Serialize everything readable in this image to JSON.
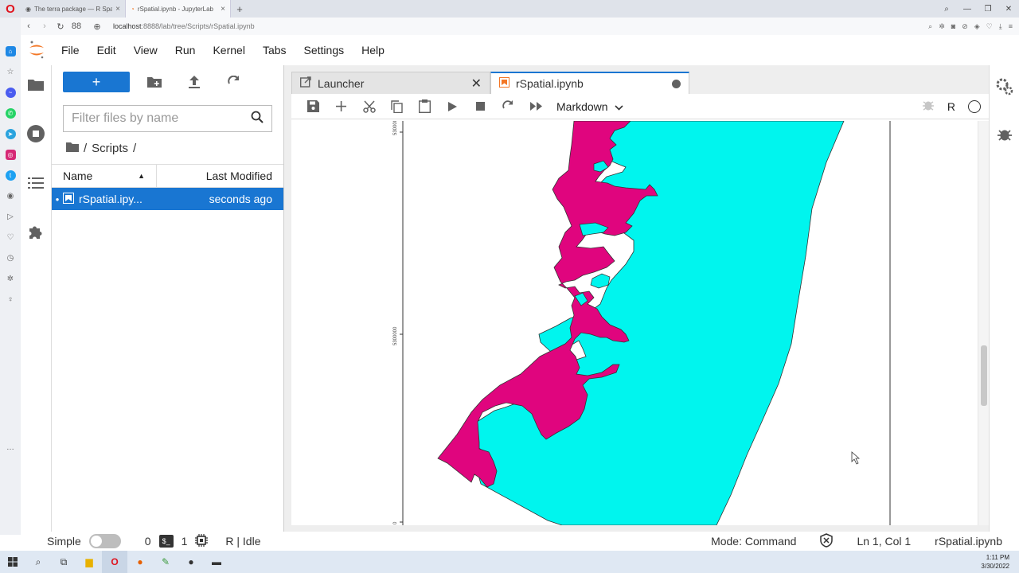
{
  "browser": {
    "tabs": [
      {
        "title": "The terra package — R Spa",
        "active": false
      },
      {
        "title": "rSpatial.ipynb - JupyterLab",
        "active": true
      }
    ],
    "address": {
      "host": "localhost",
      "path": ":8888/lab/tree/Scripts/rSpatial.ipynb",
      "badge": "88"
    }
  },
  "menubar": {
    "items": [
      "File",
      "Edit",
      "View",
      "Run",
      "Kernel",
      "Tabs",
      "Settings",
      "Help"
    ]
  },
  "filebrowser": {
    "new_label": "+",
    "filter_placeholder": "Filter files by name",
    "breadcrumb": [
      "/",
      "Scripts",
      "/"
    ],
    "columns": {
      "name": "Name",
      "modified": "Last Modified"
    },
    "files": [
      {
        "name": "rSpatial.ipy...",
        "modified": "seconds ago"
      }
    ]
  },
  "doctabs": [
    {
      "label": "Launcher",
      "active": false
    },
    {
      "label": "rSpatial.ipynb",
      "active": true
    }
  ],
  "notebook": {
    "cell_type": "Markdown",
    "kernel_name": "R",
    "plot": {
      "ytick_labels": [
        "5300000",
        "5300000",
        "0"
      ],
      "colors": {
        "land": "#e0057e",
        "water": "#00f5ee"
      }
    }
  },
  "statusbar": {
    "mode_label": "Simple",
    "terminals_count": "0",
    "kernels_count": "1",
    "kernel_status": "R | Idle",
    "mode": "Mode: Command",
    "cursor": "Ln 1, Col 1",
    "file": "rSpatial.ipynb"
  },
  "taskbar": {
    "time": "1:11 PM",
    "date": "3/30/2022"
  },
  "colors": {
    "accent": "#1976d2"
  }
}
